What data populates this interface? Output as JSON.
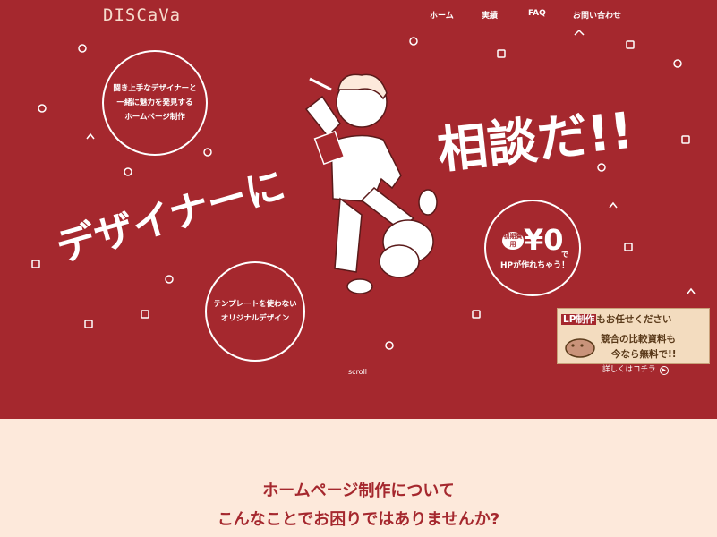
{
  "header": {
    "logo": "DISCaVa",
    "nav": [
      "ホーム",
      "実績",
      "FAQ",
      "お問い合わせ"
    ]
  },
  "hero": {
    "circle1": [
      "闘き上手なデザイナーと",
      "一緒に魅力を発見する",
      "ホームページ制作"
    ],
    "circle2": [
      "テンプレートを使わない",
      "オリジナルデザイン"
    ],
    "circle3": {
      "top": "初期費用",
      "price": "¥0",
      "suffix": "で",
      "bottom": "HPが作れちゃう！"
    },
    "headline1": "相談だ!!",
    "headline2": "デザイナーに",
    "scroll": "scroll"
  },
  "banner": {
    "lp": "LP制作",
    "line1_rest": "もお任せください",
    "line2": "競合の比較資料も",
    "line3": "今なら無料で!!",
    "details": "詳しくはコチラ",
    "details_icon": "arrow-circle-icon"
  },
  "section": {
    "title_line1": "ホームページ制作について",
    "title_line2": "こんなことでお困りではありませんか?"
  },
  "colors": {
    "hero_bg": "#a5282e",
    "bottom_bg": "#fde9db",
    "accent": "#a5282e"
  }
}
